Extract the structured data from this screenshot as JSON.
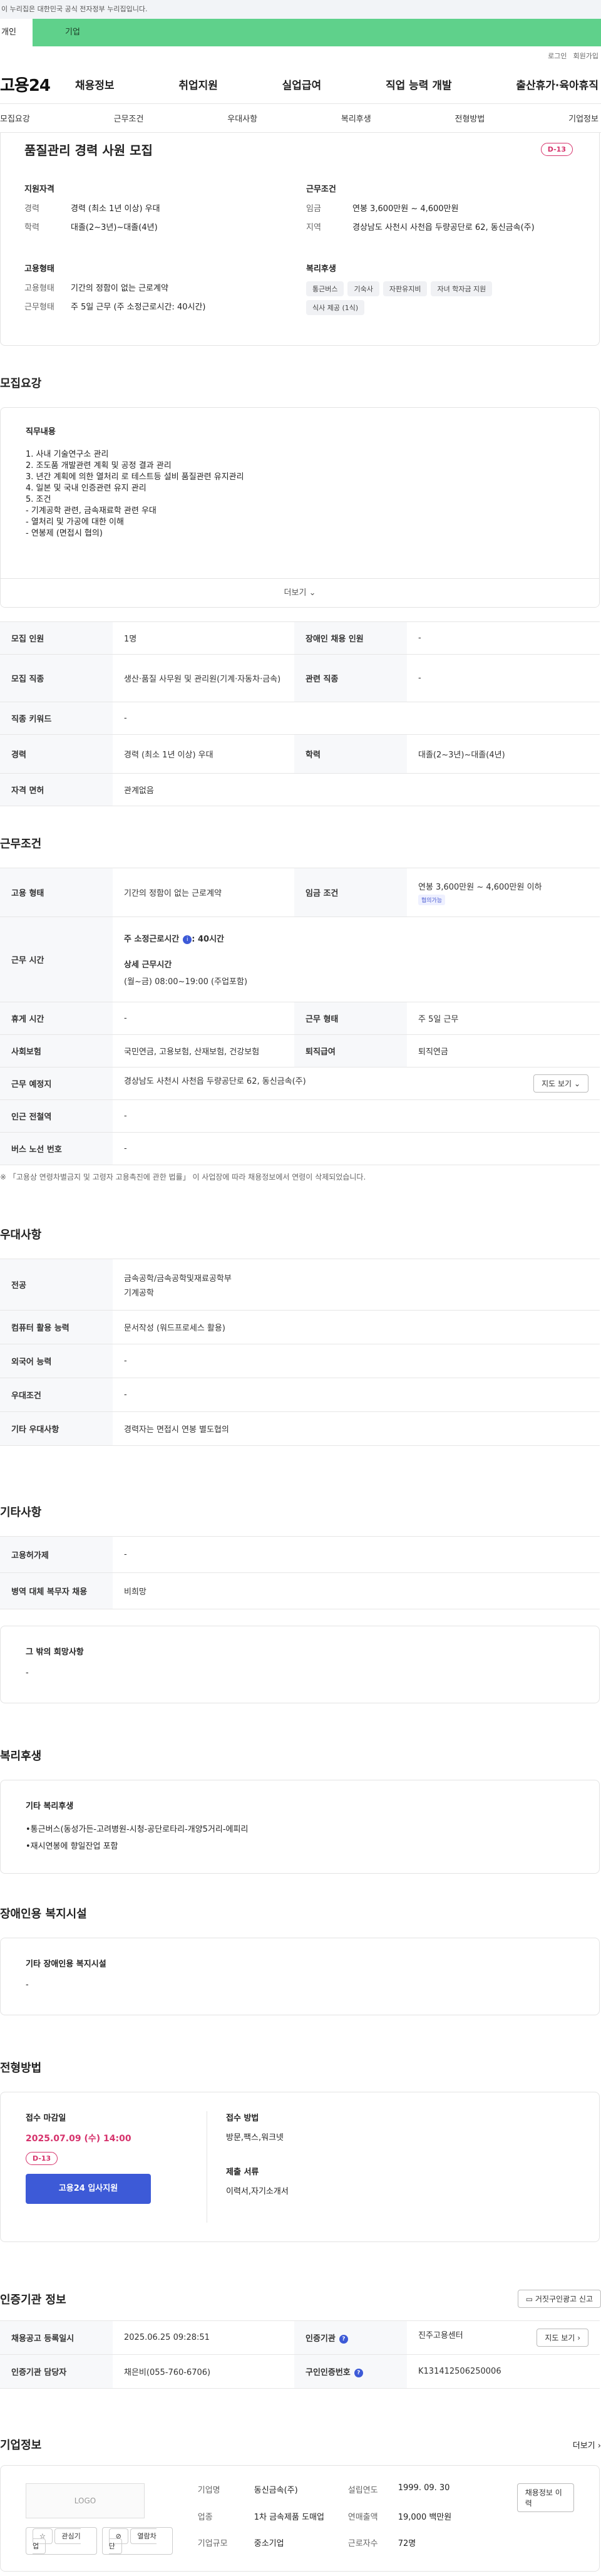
{
  "gov_banner": "이 누리집은 대한민국 공식 전자정부 누리집입니다.",
  "seg": {
    "a": "개인",
    "b": "기업"
  },
  "toplinks": {
    "login": "로그인",
    "signup": "회원가입"
  },
  "logo": "고용24",
  "gnb": [
    "채용정보",
    "취업지원",
    "실업급여",
    "직업 능력 개발",
    "출산휴가·육아휴직"
  ],
  "subnav": [
    "모집요강",
    "근무조건",
    "우대사항",
    "복리후생",
    "전형방법",
    "기업정보"
  ],
  "summary": {
    "title": "품질관리 경력 사원 모집",
    "dday": "D-13",
    "qual_h": "지원자격",
    "career_k": "경력",
    "career_v": "경력 (최소 1년 이상) 우대",
    "edu_k": "학력",
    "edu_v": "대졸(2~3년)~대졸(4년)",
    "cond_h": "근무조건",
    "wage_k": "임금",
    "wage_v": "연봉 3,600만원 ~ 4,600만원",
    "region_k": "지역",
    "region_v": "경상남도 사천시 사천읍 두량공단로 62, 동신금속(주)",
    "emp_h": "고용형태",
    "emptype_k": "고용형태",
    "emptype_v": "기간의 정함이 없는 근로계약",
    "worktype_k": "근무형태",
    "worktype_v": "주 5일 근무 (주 소정근로시간: 40시간)",
    "welfare_h": "복리후생",
    "tags": [
      "통근버스",
      "기숙사",
      "자판유지비",
      "자녀 학자금 지원",
      "식사 제공 (1식)"
    ]
  },
  "recruit": {
    "title": "모집요강",
    "duty_h": "직무내용",
    "duty_lines": [
      "1. 사내 기술연구소 관리",
      "2. 조도품 개발관련 계획 및 공정 결과 관리",
      "3. 년간 계획에 의한 열처리 로 테스트등 설비 품질관련 유지관리",
      "4. 일본 및 국내 인증관련 유지 관리",
      "5. 조건",
      "- 기계공학 관련, 금속재료학 관련 우대",
      "- 열처리 및 가공에 대한 이해",
      "- 연봉제 (면접시 협의)"
    ],
    "more": "더보기",
    "rows": [
      {
        "k1": "모집 인원",
        "v1": "1명",
        "k2": "장애인 채용 인원",
        "v2": "-"
      },
      {
        "k1": "모집 직종",
        "v1": "생산·품질 사무원 및 관리원(기계·자동차·금속)",
        "k2": "관련 직종",
        "v2": "-"
      },
      {
        "k1": "직종 키워드",
        "v1": "-"
      },
      {
        "k1": "경력",
        "v1": "경력 (최소 1년 이상) 우대",
        "k2": "학력",
        "v2": "대졸(2~3년)~대졸(4년)"
      },
      {
        "k1": "자격 면허",
        "v1": "관계없음"
      }
    ]
  },
  "work": {
    "title": "근무조건",
    "emp_k": "고용 형태",
    "emp_v": "기간의 정함이 없는 근로계약",
    "wage_k": "임금 조건",
    "wage_v": "연봉 3,600만원 ~ 4,600만원 이하",
    "wage_badge": "협의가능",
    "time_k": "근무 시간",
    "time_main": "주 소정근로시간",
    "time_val": ": 40시간",
    "time_detail_h": "상세 근무시간",
    "time_detail": "(월~금) 08:00~19:00 (주업포함)",
    "rest_k": "휴게 시간",
    "rest_v": "-",
    "form_k": "근무 형태",
    "form_v": "주 5일 근무",
    "ins_k": "사회보험",
    "ins_v": "국민연금, 고용보험, 산재보험, 건강보험",
    "ret_k": "퇴직급여",
    "ret_v": "퇴직연금",
    "place_k": "근무 예정지",
    "place_v": "경상남도 사천시 사천읍 두량공단로 62, 동신금속(주)",
    "map_btn": "지도 보기",
    "sub_k": "인근 전철역",
    "sub_v": "-",
    "bus_k": "버스 노선 번호",
    "bus_v": "-",
    "note": "※ 「고용상 연령차별금지 및 고령자 고용촉진에 관한 법률」 이 사업장에 따라 채용정보에서 연령이 삭제되었습니다."
  },
  "pref": {
    "title": "우대사항",
    "major_k": "전공",
    "major_v1": "금속공학/금속공학및재료공학부",
    "major_v2": "기계공학",
    "pc_k": "컴퓨터 활용 능력",
    "pc_v": "문서작성 (워드프로세스 활용)",
    "lang_k": "외국어 능력",
    "lang_v": "-",
    "cond_k": "우대조건",
    "cond_v": "-",
    "etc_k": "기타 우대사항",
    "etc_v": "경력자는 면접시 연봉 별도협의"
  },
  "etc": {
    "title": "기타사항",
    "ins_k": "고용허가제",
    "ins_v": "-",
    "mil_k": "병역 대체 복무자 채용",
    "mil_v": "비희망",
    "other_h": "그 밖의 희망사항",
    "other_v": "-"
  },
  "welfare": {
    "title": "복리후생",
    "h": "기타 복리후생",
    "lines": [
      "•통근버스(동성가든-고려병원-시청-공단로타리-개양5거리-에피리",
      "•재시연봉에 향일잔업 포함"
    ]
  },
  "disabled": {
    "title": "장애인용 복지시설",
    "h": "기타 장애인용 복지시설",
    "v": "-"
  },
  "process": {
    "title": "전형방법",
    "deadline_h": "접수 마감일",
    "deadline_v": "2025.07.09 (수) 14:00",
    "dday": "D-13",
    "apply_btn": "고용24 입사지원",
    "method_h": "접수 방법",
    "method_v": "방문,팩스,워크넷",
    "docs_h": "제출 서류",
    "docs_v": "이력서,자기소개서"
  },
  "cert": {
    "title": "인증기관 정보",
    "report_btn": "거짓구인광고 신고",
    "reg_k": "채용공고 등록일시",
    "reg_v": "2025.06.25 09:28:51",
    "org_k": "인증기관",
    "org_v": "진주고용센터",
    "map_btn": "지도 보기",
    "mgr_k": "인증기관 담당자",
    "mgr_v": "채은비(055-760-6706)",
    "num_k": "구인인증번호",
    "num_v": "K131412506250006"
  },
  "company": {
    "title": "기업정보",
    "more": "더보기",
    "logo": "LOGO",
    "fav_btn": "관심기업",
    "block_btn": "열람차단",
    "name_k": "기업명",
    "name_v": "동신금속(주)",
    "year_k": "설립연도",
    "year_v": "1999. 09. 30",
    "ind_k": "업종",
    "ind_v": "1차 금속제품 도매업",
    "sales_k": "연매출액",
    "sales_v": "19,000 백만원",
    "size_k": "기업규모",
    "size_v": "중소기업",
    "emp_k": "근로자수",
    "emp_v": "72명",
    "jobs_btn": "채용정보 이력"
  }
}
